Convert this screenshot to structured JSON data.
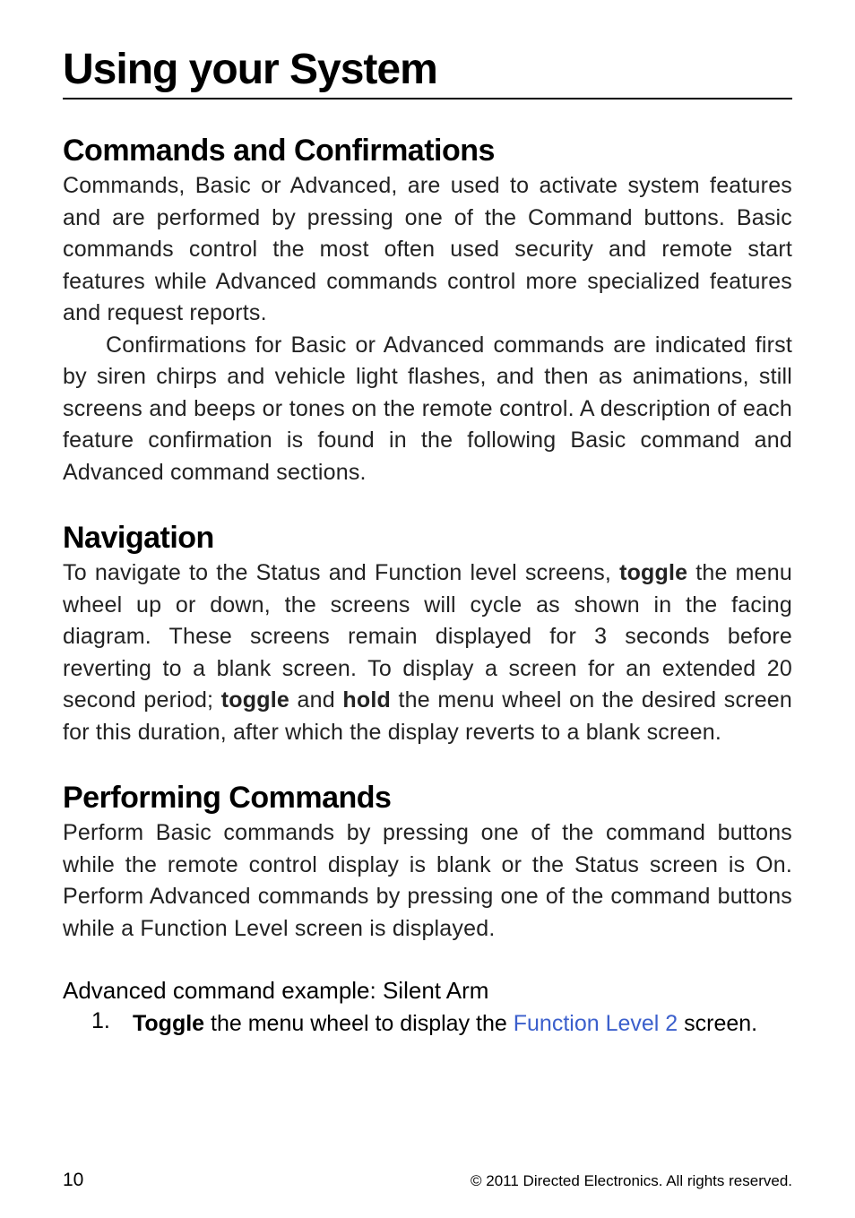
{
  "heading": "Using your System",
  "section1": {
    "title": "Commands and Confirmations",
    "p1": "Commands, Basic or Advanced, are used to activate system features and are performed by pressing one of the Command buttons. Basic commands control the most often used security and remote start features while Advanced commands control more specialized features and request reports.",
    "p2": "Confirmations for Basic or Advanced commands are indicated first by siren chirps and vehicle light flashes, and then as animations, still screens and beeps or tones on the remote control. A description of each feature confirmation is found in the following Basic command and Advanced command sections."
  },
  "section2": {
    "title": "Navigation",
    "p1a": "To navigate to the Status and Function level screens, ",
    "p1b": "toggle",
    "p1c": " the menu wheel up or down, the screens will cycle as shown in the facing diagram. These screens remain displayed for 3 seconds before reverting to a blank screen. To display a screen for an extended 20 second period; ",
    "p1d": "toggle",
    "p1e": " and ",
    "p1f": "hold",
    "p1g": " the menu wheel on the desired screen for this duration, after which the display reverts to a blank screen."
  },
  "section3": {
    "title": "Performing Commands",
    "p1": "Perform Basic commands by pressing one of the command buttons while the remote control display is blank or the Status screen is On. Perform Advanced commands by pressing one of the command buttons while a Function Level screen is displayed.",
    "subtitle": "Advanced command example: Silent Arm",
    "list1_num": "1.",
    "list1_a": "Toggle",
    "list1_b": " the menu wheel to display the ",
    "list1_c": "Function Level 2",
    "list1_d": " screen."
  },
  "footer": {
    "page": "10",
    "copyright": "© 2011 Directed Electronics. All rights reserved."
  }
}
